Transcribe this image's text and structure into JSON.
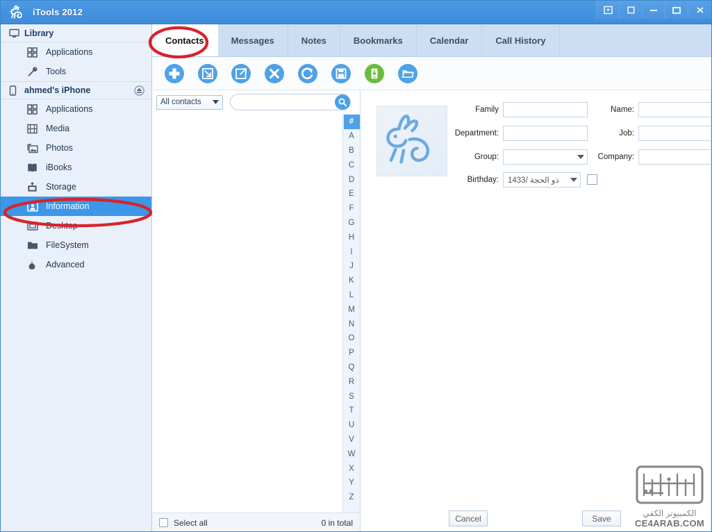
{
  "window": {
    "title": "iTools 2012",
    "logo_icon": "rabbit-logo-icon",
    "controls": [
      {
        "name": "restore-down-small-button",
        "icon": "window-down-icon"
      },
      {
        "name": "shade-button",
        "icon": "window-box-icon"
      },
      {
        "name": "minimize-button",
        "icon": "minimize-icon"
      },
      {
        "name": "maximize-button",
        "icon": "maximize-icon"
      },
      {
        "name": "close-button",
        "icon": "close-icon"
      }
    ]
  },
  "sidebar": {
    "groups": [
      {
        "label": "Library",
        "icon": "monitor-icon",
        "items": [
          {
            "label": "Applications",
            "icon": "grid-apps-icon",
            "selected": false
          },
          {
            "label": "Tools",
            "icon": "wrench-icon",
            "selected": false
          }
        ]
      },
      {
        "label": "ahmed's iPhone",
        "icon": "iphone-icon",
        "eject_icon": "eject-icon",
        "items": [
          {
            "label": "Applications",
            "icon": "grid-apps-icon",
            "selected": false
          },
          {
            "label": "Media",
            "icon": "film-icon",
            "selected": false
          },
          {
            "label": "Photos",
            "icon": "photo-icon",
            "selected": false
          },
          {
            "label": "iBooks",
            "icon": "book-icon",
            "selected": false
          },
          {
            "label": "Storage",
            "icon": "usb-storage-icon",
            "selected": false
          },
          {
            "label": "Information",
            "icon": "contact-card-icon",
            "selected": true
          },
          {
            "label": "Desktop",
            "icon": "desktop-icon",
            "selected": false
          },
          {
            "label": "FileSystem",
            "icon": "folder-icon",
            "selected": false
          },
          {
            "label": "Advanced",
            "icon": "advanced-icon",
            "selected": false
          }
        ]
      }
    ]
  },
  "tabs": [
    {
      "label": "Contacts",
      "active": true
    },
    {
      "label": "Messages",
      "active": false
    },
    {
      "label": "Notes",
      "active": false
    },
    {
      "label": "Bookmarks",
      "active": false
    },
    {
      "label": "Calendar",
      "active": false
    },
    {
      "label": "Call History",
      "active": false
    }
  ],
  "toolbar": [
    {
      "name": "add-contact-button",
      "icon": "plus-circle-icon",
      "color": "#4ea2e8"
    },
    {
      "name": "import-button",
      "icon": "arrow-down-right-box-icon",
      "color": "#4ea2e8"
    },
    {
      "name": "export-button",
      "icon": "arrow-up-right-box-icon",
      "color": "#4ea2e8"
    },
    {
      "name": "delete-button",
      "icon": "x-circle-icon",
      "color": "#4ea2e8"
    },
    {
      "name": "refresh-button",
      "icon": "refresh-circle-icon",
      "color": "#4ea2e8"
    },
    {
      "name": "save-button",
      "icon": "floppy-disk-icon",
      "color": "#4ea2e8"
    },
    {
      "name": "backup-to-device-button",
      "icon": "device-download-icon",
      "color": "#6cbb3c"
    },
    {
      "name": "open-folder-button",
      "icon": "folder-open-icon",
      "color": "#4ea2e8"
    }
  ],
  "list_pane": {
    "filter": {
      "selected": "All contacts",
      "caret_icon": "chevron-down-icon"
    },
    "search": {
      "value": "",
      "placeholder": "",
      "icon": "search-icon"
    },
    "alphabet_index": [
      "#",
      "A",
      "B",
      "C",
      "D",
      "E",
      "F",
      "G",
      "H",
      "I",
      "J",
      "K",
      "L",
      "M",
      "N",
      "O",
      "P",
      "Q",
      "R",
      "S",
      "T",
      "U",
      "V",
      "W",
      "X",
      "Y",
      "Z"
    ],
    "alphabet_active": "#"
  },
  "status_bar": {
    "select_all_label": "Select all",
    "select_all_checked": false,
    "total_label": "0 in total"
  },
  "detail": {
    "avatar_icon": "rabbit-avatar-icon",
    "fields": [
      {
        "label": "Family",
        "value": "",
        "type": "text",
        "name": "family-field"
      },
      {
        "label": "Name:",
        "value": "",
        "type": "text",
        "name": "name-field"
      },
      {
        "label": "Department:",
        "value": "",
        "type": "text",
        "name": "department-field"
      },
      {
        "label": "Job:",
        "value": "",
        "type": "text",
        "name": "job-field"
      },
      {
        "label": "Group:",
        "value": "",
        "type": "select",
        "name": "group-select"
      },
      {
        "label": "Company:",
        "value": "",
        "type": "text",
        "name": "company-field"
      },
      {
        "label": "Birthday:",
        "value": "1433/  ذو الحجة",
        "type": "select",
        "name": "birthday-select"
      }
    ],
    "birthday_checkbox_checked": false,
    "cancel_label": "Cancel",
    "save_label": "Save"
  },
  "annotations": {
    "color": "#d8232a",
    "marks": [
      {
        "name": "annotation-ellipse-contacts-tab"
      },
      {
        "name": "annotation-ellipse-information-item"
      }
    ]
  },
  "watermark": {
    "arabic": "الكمبيوتر الكفي",
    "english": "CE4ARAB.COM",
    "icon": "ce4arab-logo-icon"
  },
  "colors": {
    "titlebar": "#4392df",
    "sidebar_bg": "#eaf0f9",
    "selection": "#3c97e8",
    "tab_strip": "#ccdff2",
    "accent": "#4ea2e8",
    "green_accent": "#6cbb3c",
    "annotation_red": "#d8232a"
  }
}
